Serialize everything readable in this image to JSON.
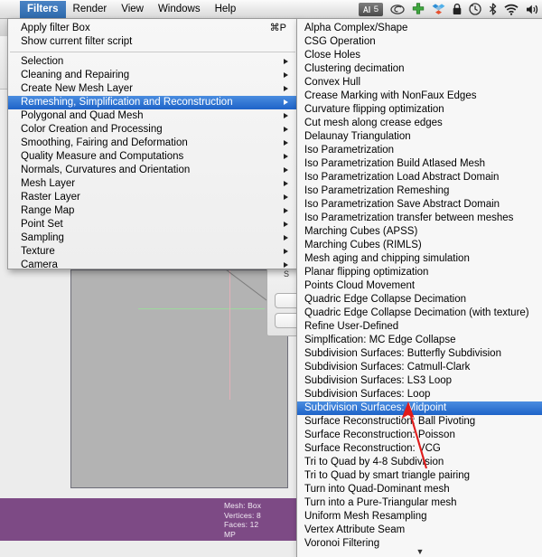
{
  "menubar": {
    "items": [
      {
        "label": "Filters",
        "active": true
      },
      {
        "label": "Render",
        "active": false
      },
      {
        "label": "View",
        "active": false
      },
      {
        "label": "Windows",
        "active": false
      },
      {
        "label": "Help",
        "active": false
      }
    ],
    "status_badge_count": "5",
    "icons": [
      "adobe-badge-icon",
      "spiral-icon",
      "green-plus-icon",
      "dropbox-icon",
      "lock-icon",
      "clock-icon",
      "bluetooth-icon",
      "wifi-icon",
      "volume-icon"
    ]
  },
  "filters_menu": {
    "items": [
      {
        "label": "Apply filter Box",
        "shortcut": "⌘P",
        "submenu": false,
        "selected": false
      },
      {
        "label": "Show current filter script",
        "shortcut": "",
        "submenu": false,
        "selected": false
      },
      {
        "separator": true
      },
      {
        "label": "Selection",
        "shortcut": "",
        "submenu": true,
        "selected": false
      },
      {
        "label": "Cleaning and Repairing",
        "shortcut": "",
        "submenu": true,
        "selected": false
      },
      {
        "label": "Create New Mesh Layer",
        "shortcut": "",
        "submenu": true,
        "selected": false
      },
      {
        "label": "Remeshing, Simplification and Reconstruction",
        "shortcut": "",
        "submenu": true,
        "selected": true
      },
      {
        "label": "Polygonal and Quad Mesh",
        "shortcut": "",
        "submenu": true,
        "selected": false
      },
      {
        "label": "Color Creation and Processing",
        "shortcut": "",
        "submenu": true,
        "selected": false
      },
      {
        "label": "Smoothing, Fairing and Deformation",
        "shortcut": "",
        "submenu": true,
        "selected": false
      },
      {
        "label": "Quality Measure and Computations",
        "shortcut": "",
        "submenu": true,
        "selected": false
      },
      {
        "label": "Normals, Curvatures and Orientation",
        "shortcut": "",
        "submenu": true,
        "selected": false
      },
      {
        "label": "Mesh Layer",
        "shortcut": "",
        "submenu": true,
        "selected": false
      },
      {
        "label": "Raster Layer",
        "shortcut": "",
        "submenu": true,
        "selected": false
      },
      {
        "label": "Range Map",
        "shortcut": "",
        "submenu": true,
        "selected": false
      },
      {
        "label": "Point Set",
        "shortcut": "",
        "submenu": true,
        "selected": false
      },
      {
        "label": "Sampling",
        "shortcut": "",
        "submenu": true,
        "selected": false
      },
      {
        "label": "Texture",
        "shortcut": "",
        "submenu": true,
        "selected": false
      },
      {
        "label": "Camera",
        "shortcut": "",
        "submenu": true,
        "selected": false
      }
    ]
  },
  "remeshing_submenu": {
    "scroll_down_glyph": "▼",
    "items": [
      {
        "label": "Alpha Complex/Shape",
        "selected": false
      },
      {
        "label": "CSG Operation",
        "selected": false
      },
      {
        "label": "Close Holes",
        "selected": false
      },
      {
        "label": "Clustering decimation",
        "selected": false
      },
      {
        "label": "Convex Hull",
        "selected": false
      },
      {
        "label": "Crease Marking with NonFaux Edges",
        "selected": false
      },
      {
        "label": "Curvature flipping optimization",
        "selected": false
      },
      {
        "label": "Cut mesh along crease edges",
        "selected": false
      },
      {
        "label": "Delaunay Triangulation",
        "selected": false
      },
      {
        "label": "Iso Parametrization",
        "selected": false
      },
      {
        "label": "Iso Parametrization Build Atlased Mesh",
        "selected": false
      },
      {
        "label": "Iso Parametrization Load Abstract Domain",
        "selected": false
      },
      {
        "label": "Iso Parametrization Remeshing",
        "selected": false
      },
      {
        "label": "Iso Parametrization Save Abstract Domain",
        "selected": false
      },
      {
        "label": "Iso Parametrization transfer between meshes",
        "selected": false
      },
      {
        "label": "Marching Cubes (APSS)",
        "selected": false
      },
      {
        "label": "Marching Cubes (RIMLS)",
        "selected": false
      },
      {
        "label": "Mesh aging and chipping simulation",
        "selected": false
      },
      {
        "label": "Planar flipping optimization",
        "selected": false
      },
      {
        "label": "Points Cloud Movement",
        "selected": false
      },
      {
        "label": "Quadric Edge Collapse Decimation",
        "selected": false
      },
      {
        "label": "Quadric Edge Collapse Decimation (with texture)",
        "selected": false
      },
      {
        "label": "Refine User-Defined",
        "selected": false
      },
      {
        "label": "Simplfication: MC Edge Collapse",
        "selected": false
      },
      {
        "label": "Subdivision Surfaces: Butterfly Subdivision",
        "selected": false
      },
      {
        "label": "Subdivision Surfaces: Catmull-Clark",
        "selected": false
      },
      {
        "label": "Subdivision Surfaces: LS3 Loop",
        "selected": false
      },
      {
        "label": "Subdivision Surfaces: Loop",
        "selected": false
      },
      {
        "label": "Subdivision Surfaces: Midpoint",
        "selected": true
      },
      {
        "label": "Surface Reconstruction: Ball Pivoting",
        "selected": false
      },
      {
        "label": "Surface Reconstruction: Poisson",
        "selected": false
      },
      {
        "label": "Surface Reconstruction: VCG",
        "selected": false
      },
      {
        "label": "Tri to Quad by 4-8 Subdivision",
        "selected": false
      },
      {
        "label": "Tri to Quad by smart triangle pairing",
        "selected": false
      },
      {
        "label": "Turn into Quad-Dominant mesh",
        "selected": false
      },
      {
        "label": "Turn into a Pure-Triangular mesh",
        "selected": false
      },
      {
        "label": "Uniform Mesh Resampling",
        "selected": false
      },
      {
        "label": "Vertex Attribute Seam",
        "selected": false
      },
      {
        "label": "Voronoi Filtering",
        "selected": false
      }
    ]
  },
  "app": {
    "mesh_info": {
      "line1": "Mesh: Box",
      "line2": "Vertices: 8",
      "line3": "Faces: 12",
      "line4": "MP"
    },
    "side_panel_label": "S"
  },
  "colors": {
    "menu_highlight": "#1e63c8",
    "menubar_active": "#2f6bae",
    "mesh_band": "#7d4a85",
    "viewport": "#b3b3b3",
    "annotation_arrow": "#e01b1b",
    "wallpaper_top": "#4a4a9e",
    "wallpaper_bottom": "#7c80ea"
  }
}
